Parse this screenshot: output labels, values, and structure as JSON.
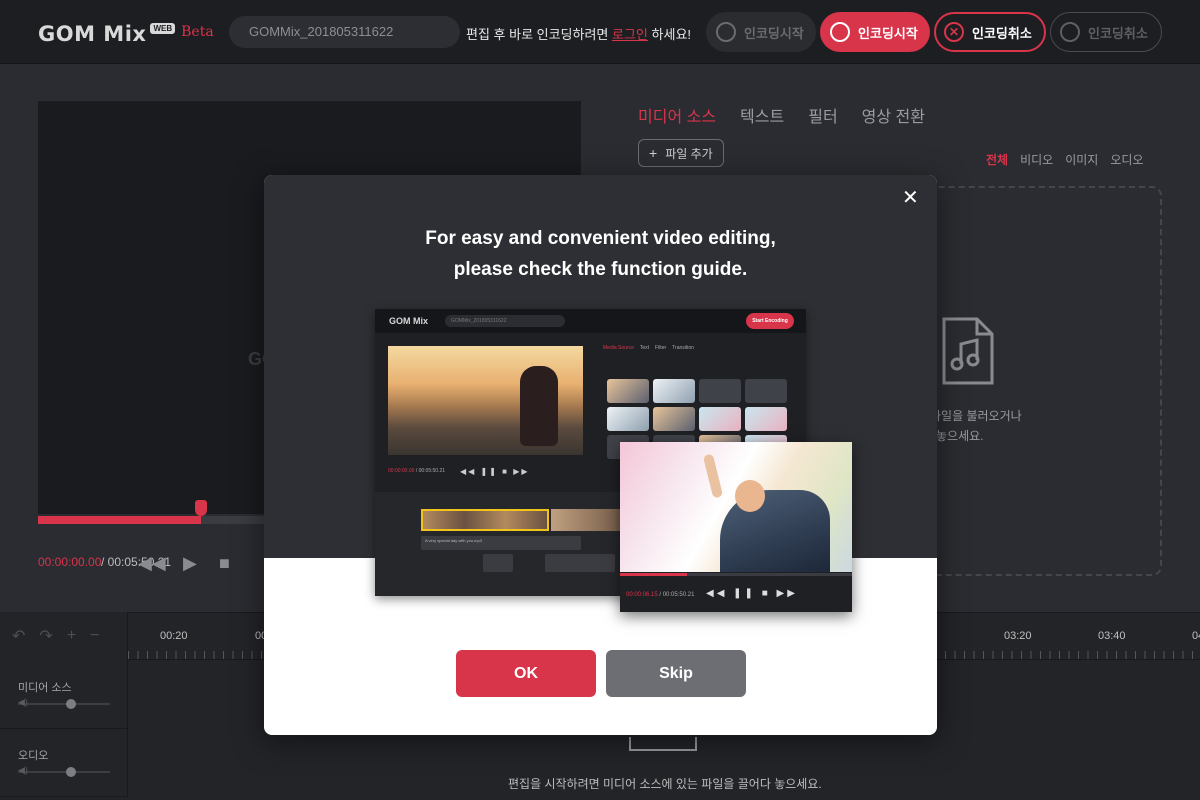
{
  "header": {
    "logo": "GOM Mix",
    "logo_badge": "WEB",
    "logo_beta": "Beta",
    "project_name": "GOMMix_201805311622",
    "login_prefix": "편집 후 바로 인코딩하려면 ",
    "login_link": "로그인",
    "login_suffix": " 하세요!",
    "buttons": [
      {
        "label": "인코딩시작",
        "icon": "film-reel-icon",
        "state": "disabled"
      },
      {
        "label": "인코딩시작",
        "icon": "film-reel-icon",
        "state": "active"
      },
      {
        "label": "인코딩취소",
        "icon": "close-circle-icon",
        "state": "outlined"
      },
      {
        "label": "인코딩취소",
        "icon": "film-reel-icon",
        "state": "disabled"
      }
    ]
  },
  "preview": {
    "time_current": "00:00:00.00",
    "time_total": "/ 00:05:50.21",
    "progress": 0.3,
    "controls": [
      "rewind-icon",
      "play-icon",
      "stop-icon"
    ]
  },
  "media_panel": {
    "tabs": [
      {
        "label": "미디어 소스",
        "active": true
      },
      {
        "label": "텍스트",
        "active": false
      },
      {
        "label": "필터",
        "active": false
      },
      {
        "label": "영상 전환",
        "active": false
      }
    ],
    "add_file": "파일 추가",
    "filters": [
      {
        "label": "전체",
        "active": true
      },
      {
        "label": "비디오",
        "active": false
      },
      {
        "label": "이미지",
        "active": false
      },
      {
        "label": "오디오",
        "active": false
      }
    ],
    "drop_text_line1": "파일을 불러오거나",
    "drop_text_line2": "놓으세요."
  },
  "timeline": {
    "ruler_ticks": [
      "00:20",
      "00",
      "03:20",
      "03:40",
      "04"
    ],
    "tracks": [
      {
        "label": "미디어 소스"
      },
      {
        "label": "오디오"
      }
    ],
    "hint": "편집을 시작하려면 미디어 소스에 있는 파일을 끌어다 놓으세요."
  },
  "modal": {
    "title_line1": "For easy and convenient video editing,",
    "title_line2": "please check the function guide.",
    "ok_label": "OK",
    "skip_label": "Skip",
    "guide_shot": {
      "logo": "GOM Mix",
      "project": "GOMMix_201805311622",
      "encoding_button": "Start Encoding",
      "tabs": [
        "Media Source",
        "Text",
        "Filter",
        "Transition"
      ],
      "time_current": "00:00:00.00",
      "time_total": "/ 00:05:50.21",
      "audio_clip": "A very special day with you.mp3"
    },
    "guide_zoom": {
      "time_current": "00:00:06.15",
      "time_total": "/ 00:05:50.21",
      "progress": 0.29
    }
  },
  "colors": {
    "accent": "#d8344a",
    "background": "#2b2c31",
    "header": "#1d1e22"
  }
}
